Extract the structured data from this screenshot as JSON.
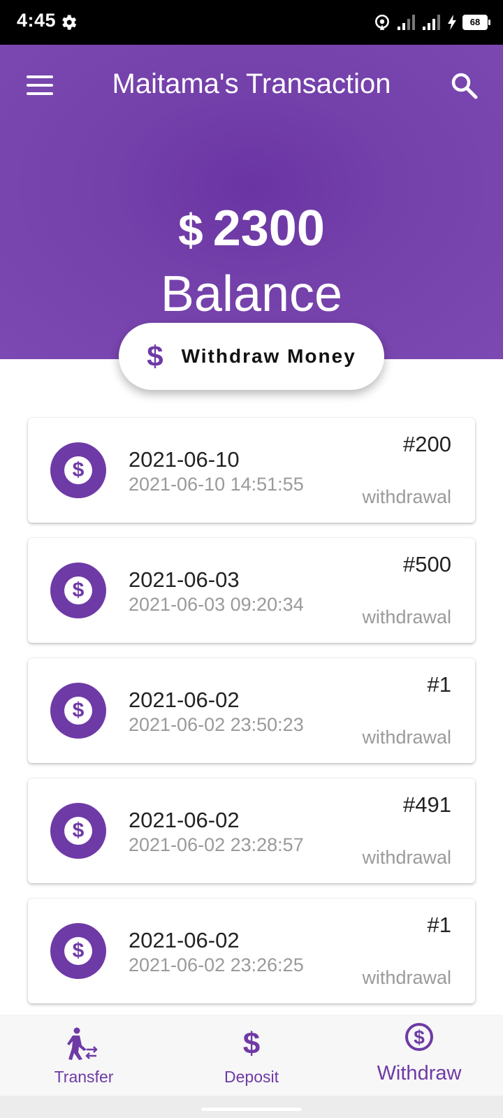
{
  "status_bar": {
    "time": "4:45",
    "battery": "68"
  },
  "app_bar": {
    "title": "Maitama's Transaction"
  },
  "balance": {
    "currency_symbol": "$",
    "amount": "2300",
    "label": "Balance"
  },
  "withdraw_button": {
    "icon_glyph": "$",
    "label": "Withdraw Money"
  },
  "transactions": [
    {
      "date": "2021-06-10",
      "datetime": "2021-06-10 14:51:55",
      "amount": "#200",
      "type": "withdrawal"
    },
    {
      "date": "2021-06-03",
      "datetime": "2021-06-03 09:20:34",
      "amount": "#500",
      "type": "withdrawal"
    },
    {
      "date": "2021-06-02",
      "datetime": "2021-06-02 23:50:23",
      "amount": "#1",
      "type": "withdrawal"
    },
    {
      "date": "2021-06-02",
      "datetime": "2021-06-02 23:28:57",
      "amount": "#491",
      "type": "withdrawal"
    },
    {
      "date": "2021-06-02",
      "datetime": "2021-06-02 23:26:25",
      "amount": "#1",
      "type": "withdrawal"
    }
  ],
  "bottom_nav": {
    "items": [
      {
        "label": "Transfer",
        "icon": "transfer-icon"
      },
      {
        "label": "Deposit",
        "icon": "deposit-icon"
      },
      {
        "label": "Withdraw",
        "icon": "withdraw-icon"
      }
    ],
    "active_index": 2
  },
  "colors": {
    "primary": "#7440aa",
    "accent": "#6e3aa6",
    "status_bar": "#000000",
    "secondary_text": "#9a9a9a"
  },
  "icons": {
    "tx_icon": "dollar-circle-icon",
    "menu": "menu-icon",
    "search": "search-icon"
  }
}
